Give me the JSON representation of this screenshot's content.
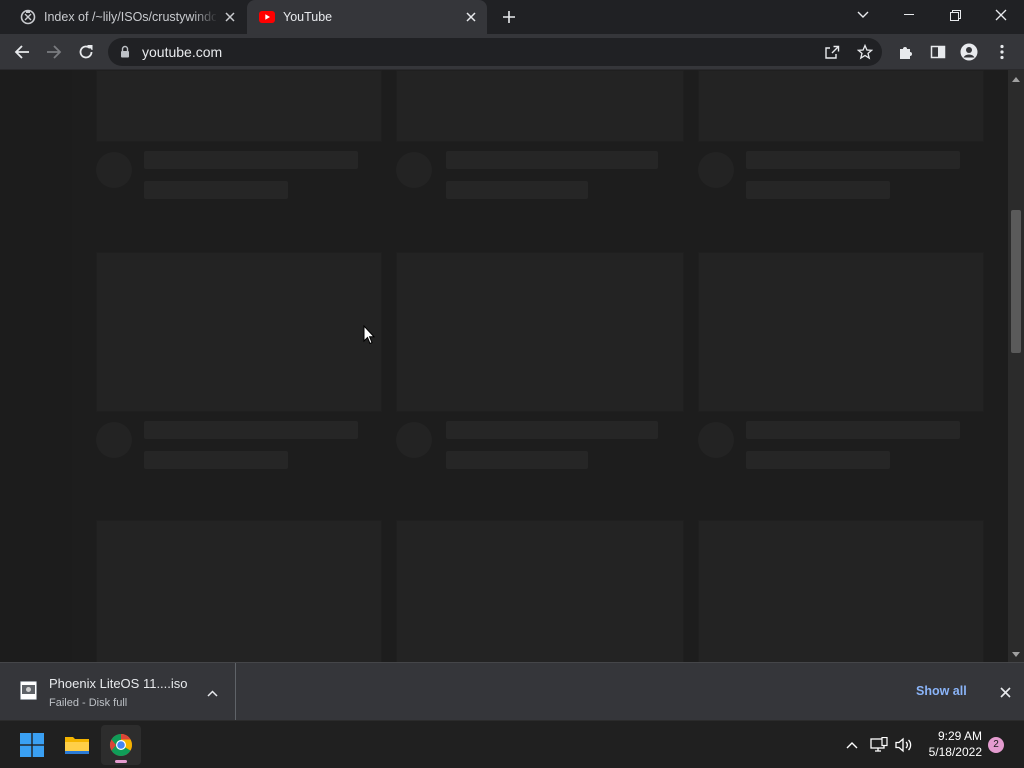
{
  "browser": {
    "tabs": [
      {
        "title": "Index of /~lily/ISOs/crustywindows",
        "favicon": "archive-favicon-icon",
        "active": false
      },
      {
        "title": "YouTube",
        "favicon": "youtube-favicon-icon",
        "active": true
      }
    ],
    "address": "youtube.com"
  },
  "download_shelf": {
    "file_name": "Phoenix LiteOS 11....iso",
    "status": "Failed - Disk full",
    "show_all_label": "Show all"
  },
  "taskbar": {
    "time": "9:29 AM",
    "date": "5/18/2022",
    "notification_count": "2",
    "apps": [
      "start-button",
      "file-explorer",
      "chrome"
    ]
  },
  "colors": {
    "tab_strip": "#202124",
    "toolbar": "#35363a",
    "page_bg": "#181818",
    "placeholder": "#232323",
    "link_blue": "#8ab4f8",
    "notification_badge": "#e49ccf",
    "youtube_red": "#ff0000"
  }
}
